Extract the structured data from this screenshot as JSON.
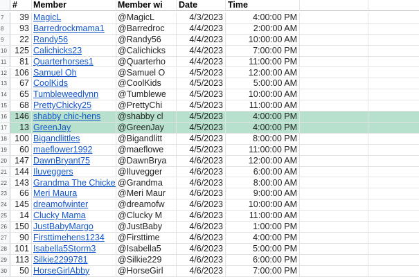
{
  "header": {
    "num": "#",
    "member": "Member",
    "handle": "Member wi",
    "date": "Date",
    "time": "Time"
  },
  "rows": [
    {
      "rn": "7",
      "num": "39",
      "member": "MagicL",
      "handle": "@MagicL",
      "date": "4/3/2023",
      "time": "4:00:00 PM",
      "highlight": false
    },
    {
      "rn": "8",
      "num": "93",
      "member": "Barredrockmama1",
      "handle": "@Barredroc",
      "date": "4/4/2023",
      "time": "2:00:00 AM",
      "highlight": false
    },
    {
      "rn": "9",
      "num": "22",
      "member": "Randy56",
      "handle": "@Randy56",
      "date": "4/4/2023",
      "time": "10:00:00 AM",
      "highlight": false
    },
    {
      "rn": "10",
      "num": "125",
      "member": "Calichicks23",
      "handle": "@Calichicks",
      "date": "4/4/2023",
      "time": "7:00:00 PM",
      "highlight": false
    },
    {
      "rn": "11",
      "num": "81",
      "member": "Quarterhorses1",
      "handle": "@Quarterho",
      "date": "4/4/2023",
      "time": "11:00:00 PM",
      "highlight": false
    },
    {
      "rn": "12",
      "num": "106",
      "member": "Samuel Oh",
      "handle": "@Samuel O",
      "date": "4/5/2023",
      "time": "12:00:00 AM",
      "highlight": false
    },
    {
      "rn": "13",
      "num": "67",
      "member": "CoolKids",
      "handle": "@CoolKids",
      "date": "4/5/2023",
      "time": "5:00:00 AM",
      "highlight": false
    },
    {
      "rn": "14",
      "num": "65",
      "member": "Tumbleweedlynn",
      "handle": "@Tumblewe",
      "date": "4/5/2023",
      "time": "10:00:00 AM",
      "highlight": false
    },
    {
      "rn": "15",
      "num": "68",
      "member": "PrettyChicky25",
      "handle": "@PrettyChi",
      "date": "4/5/2023",
      "time": "11:00:00 AM",
      "highlight": false
    },
    {
      "rn": "16",
      "num": "146",
      "member": "shabby chic-hens",
      "handle": "@shabby cl",
      "date": "4/5/2023",
      "time": "4:00:00 PM",
      "highlight": true
    },
    {
      "rn": "17",
      "num": "13",
      "member": "GreenJay",
      "handle": "@GreenJay",
      "date": "4/5/2023",
      "time": "4:00:00 PM",
      "highlight": true
    },
    {
      "rn": "18",
      "num": "100",
      "member": "Bigandlittles",
      "handle": "@Bigandlitt",
      "date": "4/5/2023",
      "time": "8:00:00 PM",
      "highlight": false
    },
    {
      "rn": "19",
      "num": "60",
      "member": "maeflower1992",
      "handle": "@maeflowe",
      "date": "4/5/2023",
      "time": "11:00:00 PM",
      "highlight": false
    },
    {
      "rn": "20",
      "num": "147",
      "member": "DawnBryant75",
      "handle": "@DawnBrya",
      "date": "4/6/2023",
      "time": "12:00:00 AM",
      "highlight": false
    },
    {
      "rn": "21",
      "num": "144",
      "member": "Iluveggers",
      "handle": "@Iluvegger",
      "date": "4/6/2023",
      "time": "6:00:00 AM",
      "highlight": false
    },
    {
      "rn": "22",
      "num": "143",
      "member": "Grandma The Chicken",
      "handle": "@Grandma",
      "date": "4/6/2023",
      "time": "8:00:00 AM",
      "highlight": false
    },
    {
      "rn": "23",
      "num": "66",
      "member": "Meri Maura",
      "handle": "@Meri Maur",
      "date": "4/6/2023",
      "time": "9:00:00 AM",
      "highlight": false
    },
    {
      "rn": "24",
      "num": "145",
      "member": "dreamofwinter",
      "handle": "@dreamofw",
      "date": "4/6/2023",
      "time": "10:00:00 AM",
      "highlight": false
    },
    {
      "rn": "25",
      "num": "14",
      "member": "Clucky Mama",
      "handle": "@Clucky M",
      "date": "4/6/2023",
      "time": "11:00:00 AM",
      "highlight": false
    },
    {
      "rn": "26",
      "num": "150",
      "member": "JustBabyMargo",
      "handle": "@JustBaby",
      "date": "4/6/2023",
      "time": "1:00:00 PM",
      "highlight": false
    },
    {
      "rn": "27",
      "num": "90",
      "member": "Firsttimehens1234",
      "handle": "@Firsttime",
      "date": "4/6/2023",
      "time": "4:00:00 PM",
      "highlight": false
    },
    {
      "rn": "28",
      "num": "101",
      "member": "Isabella5Storm3",
      "handle": "@Isabella5",
      "date": "4/6/2023",
      "time": "5:00:00 PM",
      "highlight": false
    },
    {
      "rn": "29",
      "num": "113",
      "member": "Silkie2299781",
      "handle": "@Silkie229",
      "date": "4/6/2023",
      "time": "6:00:00 PM",
      "highlight": false
    },
    {
      "rn": "30",
      "num": "50",
      "member": "HorseGirlAbby",
      "handle": "@HorseGirl",
      "date": "4/6/2023",
      "time": "7:00:00 PM",
      "highlight": false
    }
  ]
}
